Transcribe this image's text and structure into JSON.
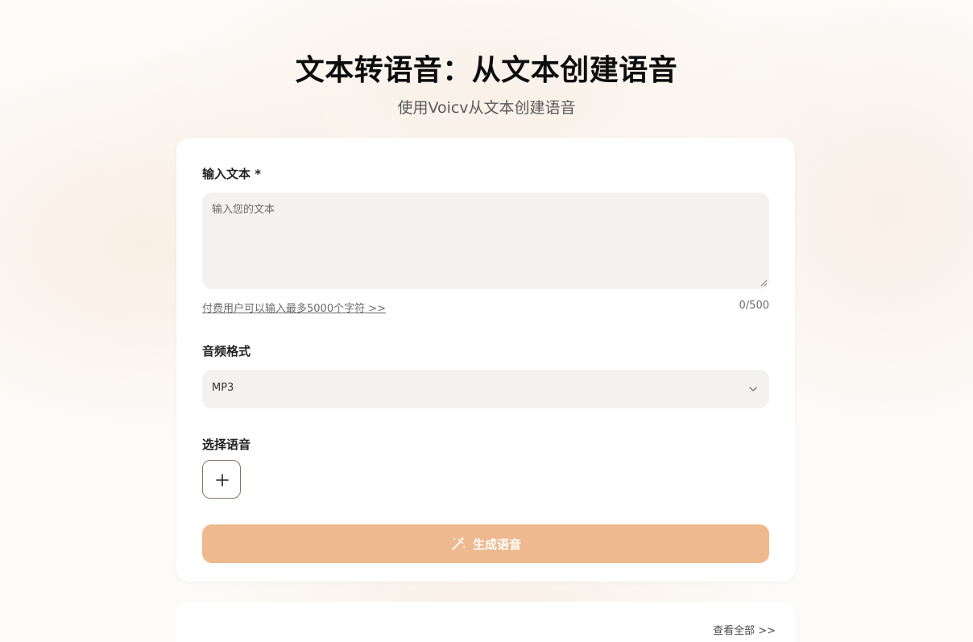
{
  "header": {
    "title": "文本转语音：从文本创建语音",
    "subtitle": "使用Voicv从文本创建语音"
  },
  "form": {
    "text_label": "输入文本 *",
    "text_placeholder": "输入您的文本",
    "text_value": "",
    "upgrade_link": "付费用户可以输入最多5000个字符 >>",
    "char_count": "0/500",
    "format_label": "音频格式",
    "format_selected": "MP3",
    "voice_label": "选择语音",
    "add_voice_icon": "plus-icon",
    "generate_icon": "magic-wand-icon",
    "generate_label": "生成语音"
  },
  "history": {
    "view_all": "查看全部 >>"
  },
  "colors": {
    "accent_button": "#eeb98e",
    "input_bg": "#f3f2f1",
    "add_voice_border": "#8a7463"
  }
}
